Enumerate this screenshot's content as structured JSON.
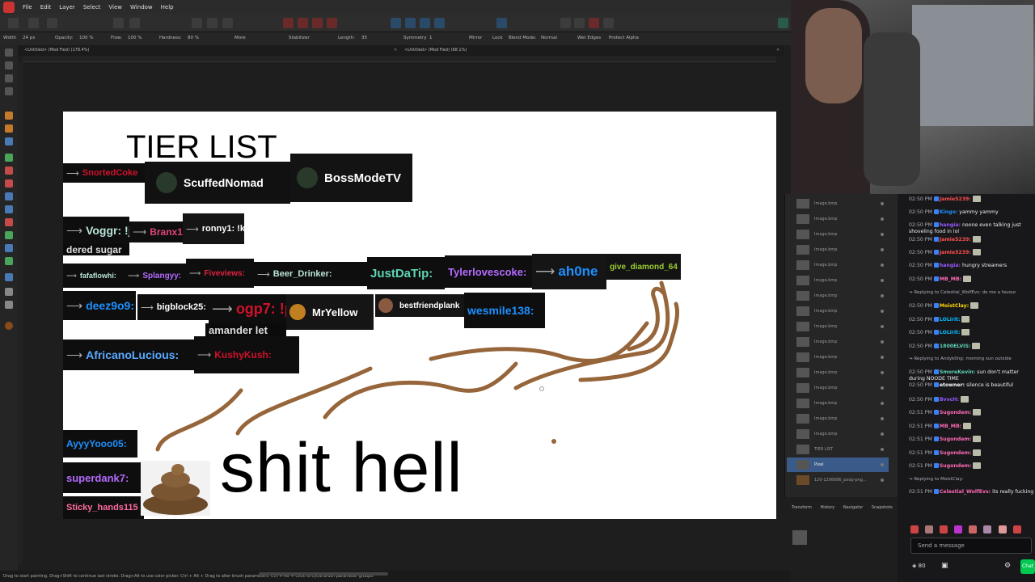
{
  "menubar": {
    "items": [
      "File",
      "Edit",
      "Layer",
      "Select",
      "View",
      "Window",
      "Help"
    ]
  },
  "context": {
    "width_label": "Width",
    "width_value": "24 px",
    "opacity_label": "Opacity:",
    "opacity_value": "100 %",
    "flow_label": "Flow:",
    "flow_value": "100 %",
    "hardness_label": "Hardness:",
    "hardness_value": "80 %",
    "more": "More",
    "stabilizer": "Stabilizer",
    "length_label": "Length:",
    "length_value": "35",
    "symmetry_label": "Symmetry",
    "symmetry_value": "1",
    "mirror": "Mirror",
    "lock": "Lock",
    "blend_label": "Blend Mode:",
    "blend_value": "Normal",
    "wet_edges": "Wet Edges",
    "protect_alpha": "Protect Alpha"
  },
  "tabs": {
    "left": "<Untitled> (Mod Fied) (178.4%)",
    "right": "<Untitled> (Mod Fied) (68.1%)"
  },
  "canvas": {
    "title": "TIER LIST",
    "caption": "shit hell",
    "tags": [
      {
        "name": "SnortedCoke",
        "color": "#d0112b"
      },
      {
        "name": "ScuffedNomad",
        "color": "#ffffff"
      },
      {
        "name": "BossModeTV",
        "color": "#ffffff"
      },
      {
        "name": "Voggr: !j",
        "color": "#b7e3d8"
      },
      {
        "name": "Branx13:",
        "color": "#e0457b"
      },
      {
        "name": "ronny1: !k",
        "color": "#ffffff"
      },
      {
        "name": "dered sugar",
        "color": "#dddddd"
      },
      {
        "name": "fafaflowhi:",
        "color": "#b7e3d8"
      },
      {
        "name": "Splangyy:",
        "color": "#b46bff"
      },
      {
        "name": "Fiveviews:",
        "color": "#e0213f"
      },
      {
        "name": "Beer_Drinker:",
        "color": "#b7e3d8"
      },
      {
        "name": "JustDaTip:",
        "color": "#5fd4b4"
      },
      {
        "name": "Tylerlovescoke:",
        "color": "#b46bff"
      },
      {
        "name": "ah0ne",
        "color": "#1e90ff"
      },
      {
        "name": "give_diamond_64",
        "color": "#9acd32"
      },
      {
        "name": "deez9o9:",
        "color": "#1e90ff"
      },
      {
        "name": "bigblock25:",
        "color": "#ffffff"
      },
      {
        "name": "ogp7: !p",
        "color": "#d0112b"
      },
      {
        "name": "MrYellow",
        "color": "#ffffff"
      },
      {
        "name": "bestfriendplank",
        "color": "#ffffff"
      },
      {
        "name": "wesmile138:",
        "color": "#1e90ff"
      },
      {
        "name": "amander let",
        "color": "#dddddd"
      },
      {
        "name": "AfricanoLucious:",
        "color": "#5aa9ff"
      },
      {
        "name": "KushyKush:",
        "color": "#d0112b"
      },
      {
        "name": "AyyyYooo05:",
        "color": "#1e90ff"
      },
      {
        "name": "superdank7:",
        "color": "#b46bff"
      },
      {
        "name": "Sticky_hands115",
        "color": "#ff6aa0"
      }
    ]
  },
  "statusbar": "Drag to start painting. Drag+Shift to continue last stroke. Drag+Alt to use color picker. Ctrl + Alt + Drag to alter brush parameters. Ctrl + Alt + Click to cycle brush parameter groups.",
  "layers": {
    "items": [
      "Image.bmp",
      "Image.bmp",
      "Image.bmp",
      "Image.bmp",
      "Image.bmp",
      "Image.bmp",
      "Image.bmp",
      "Image.bmp",
      "Image.bmp",
      "Image.bmp",
      "Image.bmp",
      "Image.bmp",
      "Image.bmp",
      "Image.bmp",
      "Image.bmp",
      "Image.bmp",
      "TIER LIST",
      "Pixel",
      "120-1206686_poop-png..."
    ],
    "tabs": [
      "Transform",
      "History",
      "Navigator",
      "Snapshots"
    ]
  },
  "chat": {
    "messages": [
      {
        "time": "02:50 PM",
        "user": "Jamie5239:",
        "color": "#ff4f4f",
        "text": ""
      },
      {
        "time": "02:50 PM",
        "user": "Kingo:",
        "color": "#1e90ff",
        "text": "yammy yammy"
      },
      {
        "time": "02:50 PM",
        "user": "hangia:",
        "color": "#9b59ff",
        "text": "noone even talking just shoveling food in lol"
      },
      {
        "time": "02:50 PM",
        "user": "Jamie5239:",
        "color": "#ff4f4f",
        "text": ""
      },
      {
        "time": "02:50 PM",
        "user": "Jamie5239:",
        "color": "#ff4f4f",
        "text": ""
      },
      {
        "time": "02:50 PM",
        "user": "hangia:",
        "color": "#9b59ff",
        "text": "hungry streamers"
      },
      {
        "time": "02:50 PM",
        "user": "MB_MB:",
        "color": "#ff69b4",
        "text": ""
      },
      {
        "time": "",
        "user": "",
        "color": "#adadb8",
        "text": "Replying to Celestial_WolfEvs: do me a favour"
      },
      {
        "time": "02:50 PM",
        "user": "MoistClay:",
        "color": "#ffd700",
        "text": ""
      },
      {
        "time": "02:50 PM",
        "user": "LOLirit:",
        "color": "#00bfff",
        "text": ""
      },
      {
        "time": "02:50 PM",
        "user": "LOLirit:",
        "color": "#00bfff",
        "text": ""
      },
      {
        "time": "02:50 PM",
        "user": "1800ELVIS:",
        "color": "#5fd4b4",
        "text": ""
      },
      {
        "time": "",
        "user": "",
        "color": "#adadb8",
        "text": "Replying to Andyk0ng: morning sun outside"
      },
      {
        "time": "02:50 PM",
        "user": "SmoreKevin:",
        "color": "#5fd4b4",
        "text": "sun don't matter during NOODE TIME"
      },
      {
        "time": "02:50 PM",
        "user": "etowner:",
        "color": "#ffffff",
        "text": "silence is beautiful"
      },
      {
        "time": "02:50 PM",
        "user": "BvvcH:",
        "color": "#9b59ff",
        "text": ""
      },
      {
        "time": "02:51 PM",
        "user": "Sugondem:",
        "color": "#ff6ab4",
        "text": ""
      },
      {
        "time": "02:51 PM",
        "user": "MB_MB:",
        "color": "#ff69b4",
        "text": ""
      },
      {
        "time": "02:51 PM",
        "user": "Sugondem:",
        "color": "#ff6ab4",
        "text": ""
      },
      {
        "time": "02:51 PM",
        "user": "Sugondem:",
        "color": "#ff6ab4",
        "text": ""
      },
      {
        "time": "02:51 PM",
        "user": "Sugondem:",
        "color": "#ff6ab4",
        "text": ""
      },
      {
        "time": "",
        "user": "",
        "color": "#adadb8",
        "text": "Replying to MoistClay:"
      },
      {
        "time": "02:51 PM",
        "user": "Celestial_WolfEvs:",
        "color": "#ff69b4",
        "text": "its really fucking loud lo"
      }
    ],
    "input_placeholder": "Send a message",
    "points": "80",
    "chat_button": "Chat"
  }
}
